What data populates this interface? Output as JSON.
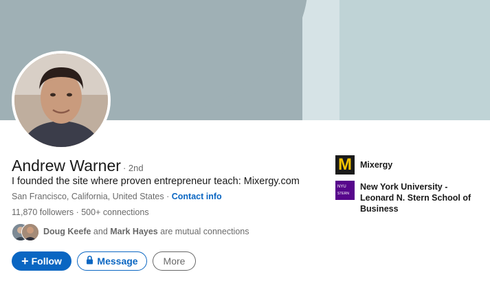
{
  "profile": {
    "name": "Andrew Warner",
    "degree": "· 2nd",
    "headline": "I founded the site where proven entrepreneur teach: Mixergy.com",
    "location": "San Francisco, California, United States",
    "separator": " · ",
    "contact_info": "Contact info",
    "followers": "11,870 followers",
    "connections": "500+ connections"
  },
  "mutual": {
    "person1": "Doug Keefe",
    "conj": " and ",
    "person2": "Mark Hayes",
    "suffix": " are mutual connections"
  },
  "actions": {
    "follow_label": "Follow",
    "message_label": "Message",
    "more_label": "More"
  },
  "experience": [
    {
      "name": "Mixergy",
      "logo_text": "M"
    },
    {
      "name": "New York University - Leonard N. Stern School of Business",
      "logo_text": "NYU",
      "logo_subtext": "STERN"
    }
  ],
  "colors": {
    "accent": "#0a66c2",
    "nyu_purple": "#57068c",
    "mixergy_yellow": "#f5c400"
  }
}
